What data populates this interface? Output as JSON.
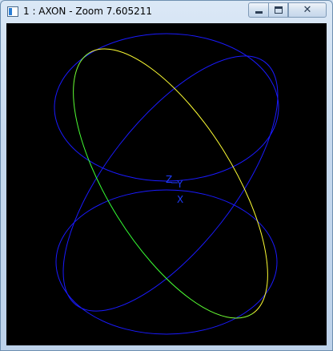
{
  "window": {
    "title": "1 : AXON - Zoom 7.605211",
    "buttons": {
      "minimize_glyph": "—",
      "maximize_glyph": "□",
      "close_glyph": "✕"
    }
  },
  "viewport": {
    "background": "#000000",
    "axis_labels": {
      "z": "Z",
      "y": "Y",
      "x": "X"
    },
    "colors": {
      "wire": "#1a1aff",
      "highlight_a": "#33ff33",
      "highlight_b": "#ffff33"
    }
  }
}
